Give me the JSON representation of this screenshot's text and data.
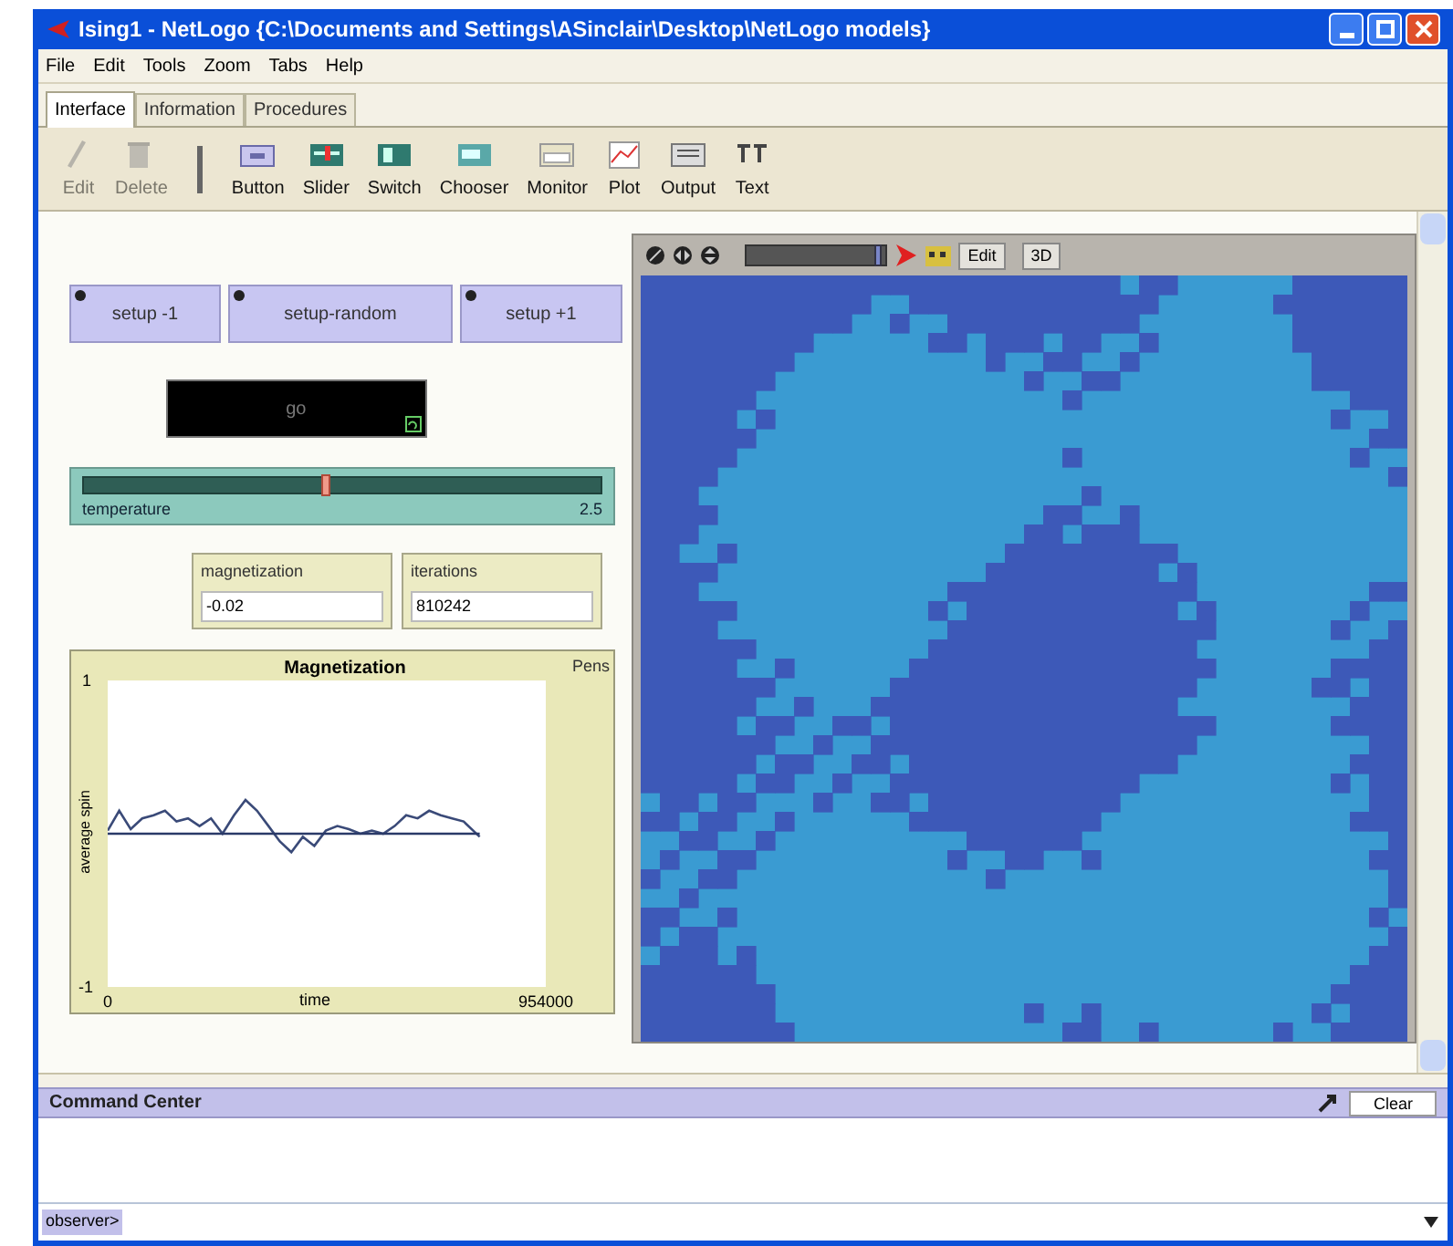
{
  "window": {
    "title": "Ising1 - NetLogo {C:\\Documents and Settings\\ASinclair\\Desktop\\NetLogo models}"
  },
  "menu": [
    "File",
    "Edit",
    "Tools",
    "Zoom",
    "Tabs",
    "Help"
  ],
  "tabs": [
    {
      "label": "Interface",
      "selected": true
    },
    {
      "label": "Information",
      "selected": false
    },
    {
      "label": "Procedures",
      "selected": false
    }
  ],
  "toolbar": [
    {
      "label": "Edit",
      "disabled": true
    },
    {
      "label": "Delete",
      "disabled": true
    },
    {
      "label": "Button",
      "disabled": false
    },
    {
      "label": "Slider",
      "disabled": false
    },
    {
      "label": "Switch",
      "disabled": false
    },
    {
      "label": "Chooser",
      "disabled": false
    },
    {
      "label": "Monitor",
      "disabled": false
    },
    {
      "label": "Plot",
      "disabled": false
    },
    {
      "label": "Output",
      "disabled": false
    },
    {
      "label": "Text",
      "disabled": false
    }
  ],
  "buttons": [
    {
      "label": "setup -1",
      "forever": false
    },
    {
      "label": "setup-random",
      "forever": false
    },
    {
      "label": "setup +1",
      "forever": false
    }
  ],
  "go_button": {
    "label": "go",
    "forever": true,
    "pressed": true
  },
  "slider": {
    "label": "temperature",
    "value": "2.5",
    "level": 0.47
  },
  "monitors": [
    {
      "label": "magnetization",
      "value": "-0.02"
    },
    {
      "label": "iterations",
      "value": "810242"
    }
  ],
  "plot": {
    "pens_label": "Pens",
    "chart_data": {
      "type": "line",
      "title": "Magnetization",
      "xlabel": "time",
      "ylabel": "average spin",
      "xlim": [
        0,
        954000
      ],
      "ylim": [
        -1,
        1
      ],
      "xticks": [
        0,
        954000
      ],
      "yticks": [
        1,
        -1
      ],
      "x": [
        0,
        25000,
        50000,
        75000,
        100000,
        125000,
        150000,
        175000,
        200000,
        225000,
        250000,
        275000,
        300000,
        325000,
        350000,
        375000,
        400000,
        425000,
        450000,
        475000,
        500000,
        525000,
        550000,
        575000,
        600000,
        625000,
        650000,
        675000,
        700000,
        725000,
        750000,
        775000,
        810242
      ],
      "series": [
        {
          "color": "#3a4a78",
          "values": [
            0.02,
            0.15,
            0.03,
            0.1,
            0.12,
            0.15,
            0.08,
            0.1,
            0.05,
            0.1,
            0.0,
            0.12,
            0.22,
            0.15,
            0.05,
            -0.05,
            -0.12,
            -0.02,
            -0.08,
            0.02,
            0.05,
            0.03,
            0.0,
            0.02,
            0.0,
            0.05,
            0.12,
            0.1,
            0.15,
            0.12,
            0.1,
            0.08,
            -0.02
          ]
        },
        {
          "color": "#2a3a68",
          "values": [
            0,
            0,
            0,
            0,
            0,
            0,
            0,
            0,
            0,
            0,
            0,
            0,
            0,
            0,
            0,
            0,
            0,
            0,
            0,
            0,
            0,
            0,
            0,
            0,
            0,
            0,
            0,
            0,
            0,
            0,
            0,
            0,
            0
          ]
        }
      ]
    }
  },
  "view": {
    "edit_label": "Edit",
    "three_d_label": "3D",
    "speed": {
      "level": 0.95
    }
  },
  "command_center": {
    "title": "Command Center",
    "clear_label": "Clear",
    "prompt": "observer>"
  }
}
